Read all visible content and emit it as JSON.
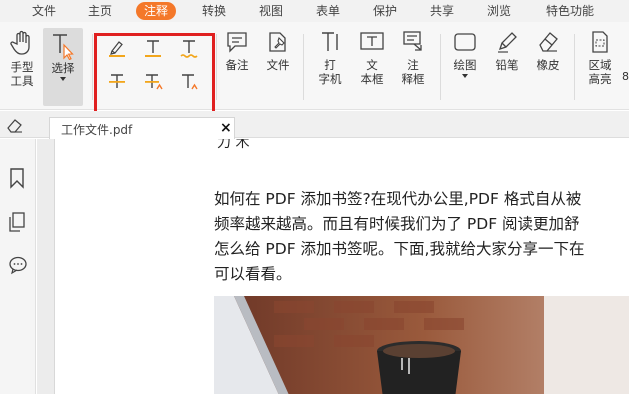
{
  "menubar": {
    "items": [
      {
        "label": "文件",
        "active": false
      },
      {
        "label": "主页",
        "active": false
      },
      {
        "label": "注释",
        "active": true
      },
      {
        "label": "转换",
        "active": false
      },
      {
        "label": "视图",
        "active": false
      },
      {
        "label": "表单",
        "active": false
      },
      {
        "label": "保护",
        "active": false
      },
      {
        "label": "共享",
        "active": false
      },
      {
        "label": "浏览",
        "active": false
      },
      {
        "label": "特色功能",
        "active": false
      }
    ]
  },
  "ribbon": {
    "hand_tool": "手型\n工具",
    "select_tool": "选择",
    "note": "备注",
    "file": "文件",
    "typewriter": "打\n字机",
    "textbox": "文\n本框",
    "callout": "注\n释框",
    "drawing": "绘图",
    "pencil": "铅笔",
    "eraser": "橡皮",
    "area_highlight": "区域\n高亮",
    "partial_label": "8"
  },
  "colors": {
    "accent": "#f4782a",
    "highlight_box": "#e02020",
    "marker_yellow": "#f2a61c",
    "caret_orange": "#f4782a"
  },
  "tab": {
    "title": "工作文件.pdf",
    "close": "×"
  },
  "document": {
    "top_fragment": "力 木",
    "lines": [
      "如何在 PDF 添加书签?在现代办公里,PDF 格式自从被",
      "频率越来越高。而且有时候我们为了 PDF 阅读更加舒",
      "怎么给 PDF 添加书签呢。下面,我就给大家分享一下在",
      "可以看看。"
    ]
  },
  "icons": {
    "hand": "hand-icon",
    "select": "text-cursor-icon",
    "highlight": "highlighter-icon",
    "underline": "underline-icon",
    "strikeout": "strikeout-icon",
    "squiggly": "squiggly-icon",
    "replace": "replace-text-icon",
    "insert": "insert-text-icon",
    "note": "note-icon",
    "file_attach": "pin-file-icon",
    "bookmark": "bookmark-icon",
    "pages": "pages-icon",
    "comments": "comment-icon",
    "eraser": "eraser-icon"
  }
}
